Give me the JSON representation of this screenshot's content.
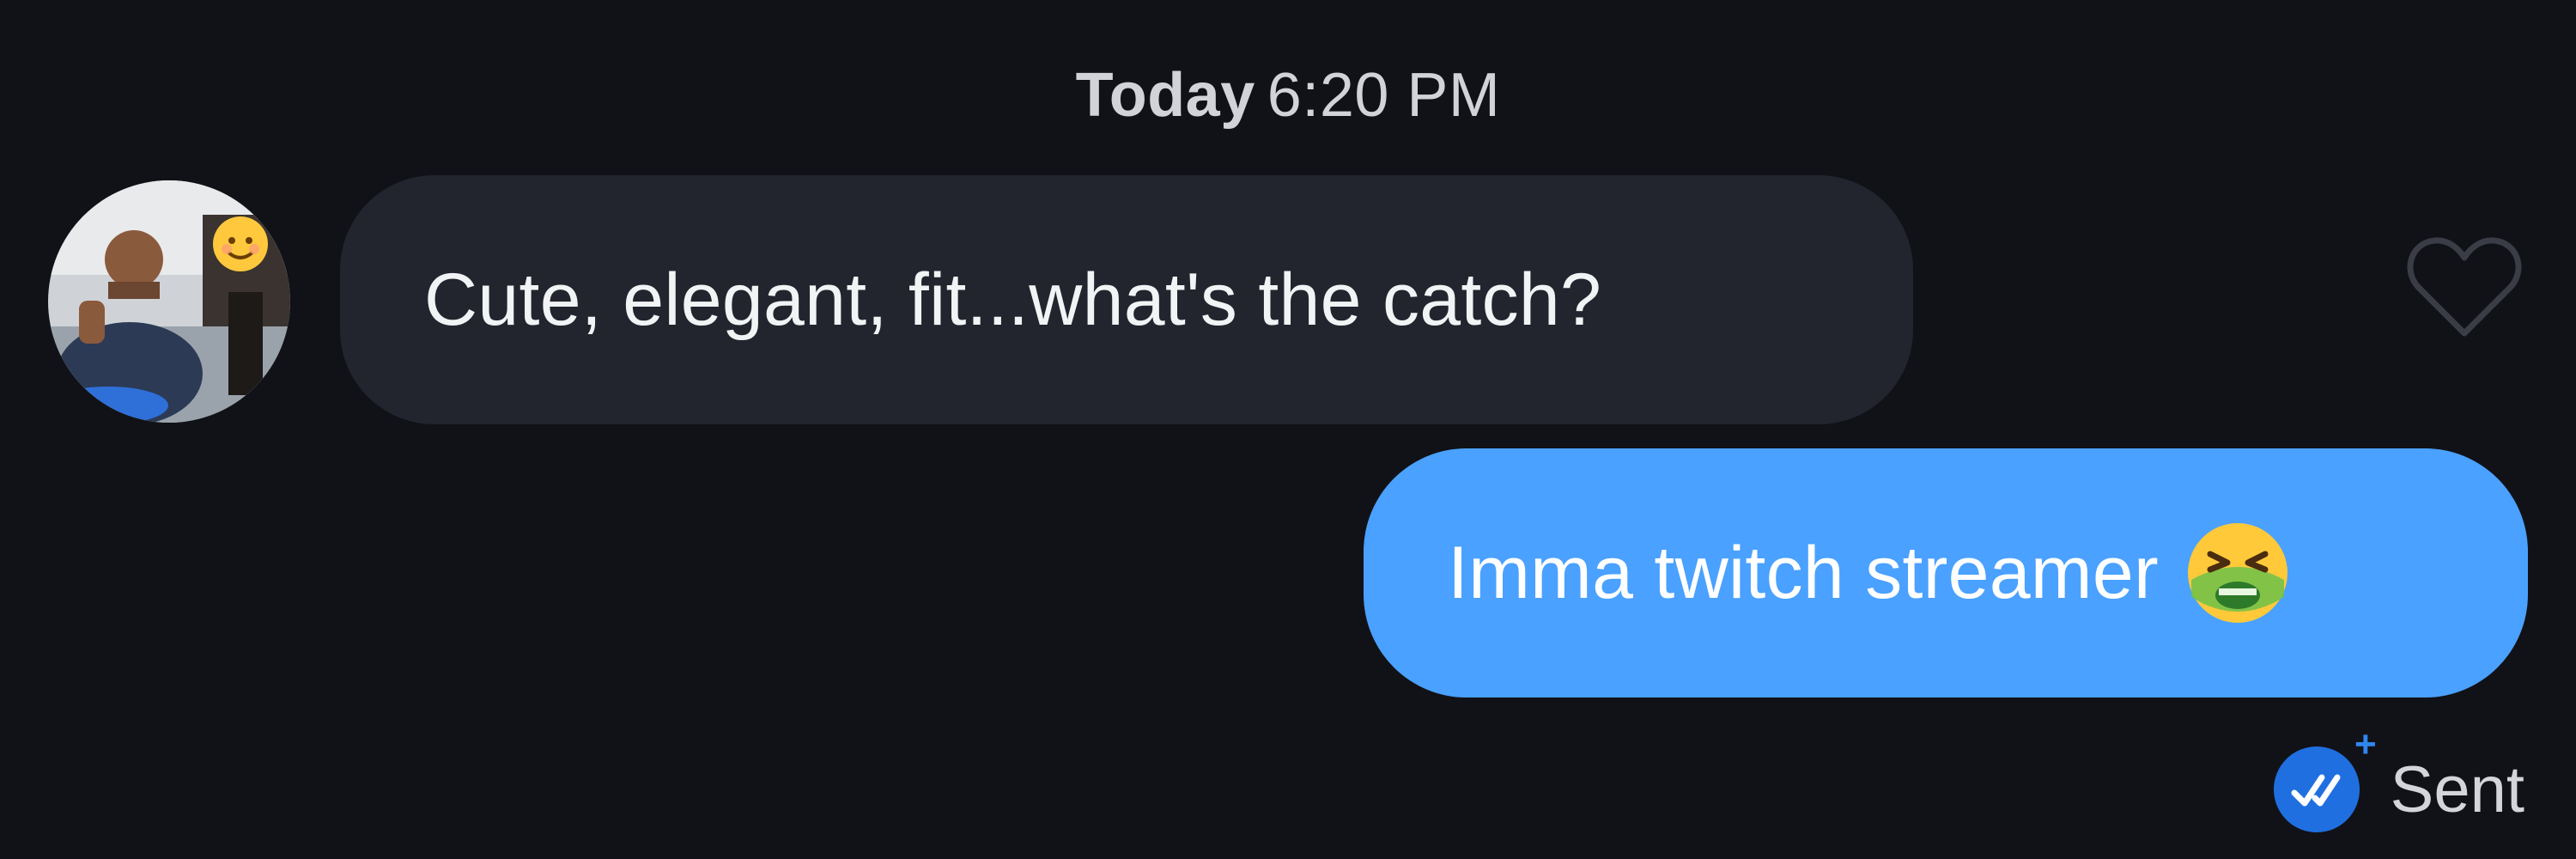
{
  "timestamp": {
    "day": "Today",
    "time": "6:20 PM"
  },
  "incoming": {
    "text": "Cute, elegant, fit...what's the catch?"
  },
  "outgoing": {
    "text": "Imma twitch streamer",
    "emoji_icon": "nauseated-face-emoji"
  },
  "receipt": {
    "label": "Sent",
    "icon": "double-check-icon",
    "badge_icon": "plus-icon"
  },
  "colors": {
    "background": "#111217",
    "incoming_bubble": "#22252e",
    "outgoing_bubble": "#4aa1ff",
    "receipt_accent": "#1f6fe0"
  }
}
